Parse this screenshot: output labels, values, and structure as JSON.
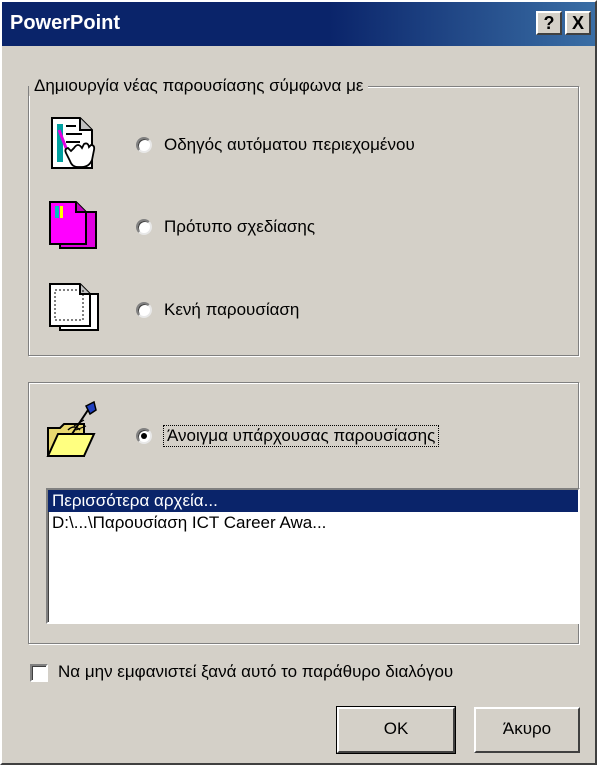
{
  "window": {
    "title": "PowerPoint",
    "help_label": "?",
    "close_label": "X"
  },
  "create_group": {
    "legend": "Δημιουργία νέας παρουσίασης σύμφωνα με",
    "options": [
      {
        "label": "Οδηγός αυτόματου περιεχομένου",
        "selected": false,
        "icon": "autocontent-wizard-icon"
      },
      {
        "label": "Πρότυπο σχεδίασης",
        "selected": false,
        "icon": "design-template-icon"
      },
      {
        "label": "Κενή παρουσίαση",
        "selected": false,
        "icon": "blank-presentation-icon"
      }
    ]
  },
  "open_group": {
    "option_label": "Άνοιγμα υπάρχουσας παρουσίασης",
    "selected": true,
    "icon": "open-folder-icon",
    "files": [
      {
        "label": "Περισσότερα αρχεία...",
        "selected": true
      },
      {
        "label": "D:\\...\\Παρουσίαση ICT Career Awa...",
        "selected": false
      }
    ]
  },
  "dont_show": {
    "label": "Να μην εμφανιστεί ξανά αυτό το παράθυρο διαλόγου",
    "checked": false
  },
  "buttons": {
    "ok_label": "OK",
    "cancel_label": "Άκυρο"
  },
  "colors": {
    "titlebar": "#0a246a",
    "face": "#d4d0c8",
    "selection": "#0a246a"
  }
}
